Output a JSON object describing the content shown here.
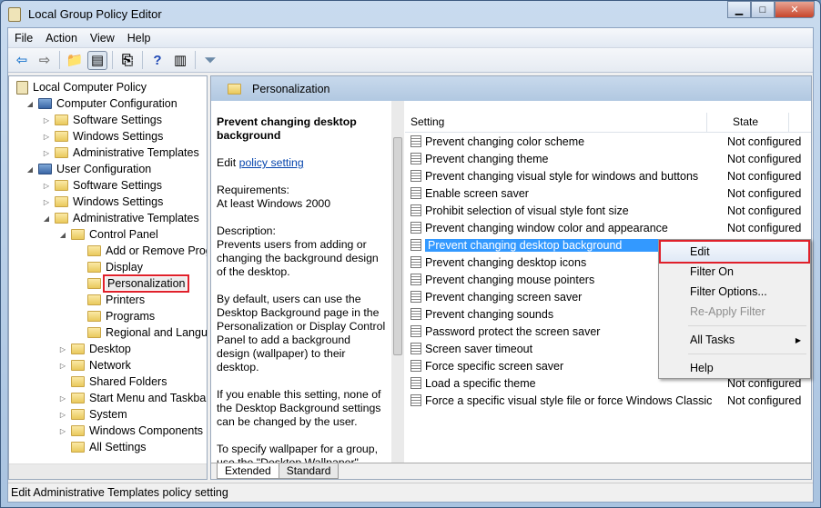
{
  "window": {
    "title": "Local Group Policy Editor",
    "minimize": "▁",
    "maximize": "□",
    "close": "✕"
  },
  "menu": [
    "File",
    "Action",
    "View",
    "Help"
  ],
  "toolbar": [
    {
      "icon": "back-arrow-icon",
      "glyph": "⇦",
      "color": "#2c7fd1"
    },
    {
      "icon": "forward-arrow-icon",
      "glyph": "⇨",
      "color": "#777777"
    },
    {
      "icon": "up-folder-icon",
      "glyph": "📁"
    },
    {
      "icon": "show-hide-tree-icon",
      "glyph": "▤",
      "on": true
    },
    {
      "icon": "export-list-icon",
      "glyph": "⎘"
    },
    {
      "icon": "help-icon",
      "glyph": "?",
      "color": "#2049b5"
    },
    {
      "icon": "show-action-pane-icon",
      "glyph": "▥"
    },
    {
      "icon": "filter-icon",
      "glyph": "⏷",
      "color": "#6b8aa8"
    }
  ],
  "tree": [
    {
      "label": "Local Computer Policy",
      "level": 0,
      "arrow": "",
      "icon": "root"
    },
    {
      "label": "Computer Configuration",
      "level": 1,
      "arrow": "◢",
      "icon": "comp"
    },
    {
      "label": "Software Settings",
      "level": 2,
      "arrow": "▷"
    },
    {
      "label": "Windows Settings",
      "level": 2,
      "arrow": "▷"
    },
    {
      "label": "Administrative Templates",
      "level": 2,
      "arrow": "▷"
    },
    {
      "label": "User Configuration",
      "level": 1,
      "arrow": "◢",
      "icon": "comp"
    },
    {
      "label": "Software Settings",
      "level": 2,
      "arrow": "▷"
    },
    {
      "label": "Windows Settings",
      "level": 2,
      "arrow": "▷"
    },
    {
      "label": "Administrative Templates",
      "level": 2,
      "arrow": "◢"
    },
    {
      "label": "Control Panel",
      "level": 3,
      "arrow": "◢"
    },
    {
      "label": "Add or Remove Programs",
      "level": 4,
      "arrow": ""
    },
    {
      "label": "Display",
      "level": 4,
      "arrow": ""
    },
    {
      "label": "Personalization",
      "level": 4,
      "arrow": "",
      "selected": true
    },
    {
      "label": "Printers",
      "level": 4,
      "arrow": ""
    },
    {
      "label": "Programs",
      "level": 4,
      "arrow": ""
    },
    {
      "label": "Regional and Language Options",
      "level": 4,
      "arrow": ""
    },
    {
      "label": "Desktop",
      "level": 3,
      "arrow": "▷"
    },
    {
      "label": "Network",
      "level": 3,
      "arrow": "▷"
    },
    {
      "label": "Shared Folders",
      "level": 3,
      "arrow": ""
    },
    {
      "label": "Start Menu and Taskbar",
      "level": 3,
      "arrow": "▷"
    },
    {
      "label": "System",
      "level": 3,
      "arrow": "▷"
    },
    {
      "label": "Windows Components",
      "level": 3,
      "arrow": "▷"
    },
    {
      "label": "All Settings",
      "level": 3,
      "arrow": ""
    }
  ],
  "main": {
    "header": "Personalization",
    "description": {
      "title": "Prevent changing desktop background",
      "edit_prefix": "Edit ",
      "edit_link": "policy setting",
      "requirements": "Requirements:\nAt least Windows 2000",
      "desc": "Description:\nPrevents users from adding or changing the background design of the desktop.",
      "p2": "By default, users can use the Desktop Background page in the Personalization or Display Control Panel to add a background design (wallpaper) to their desktop.",
      "p3": "If you enable this setting, none of the Desktop Background settings can be changed by the user.",
      "p4": "To specify wallpaper for a group, use the \"Desktop Wallpaper\" setting."
    },
    "columns": [
      "Setting",
      "State"
    ],
    "rows": [
      {
        "setting": "Prevent changing color scheme",
        "state": "Not configured"
      },
      {
        "setting": "Prevent changing theme",
        "state": "Not configured"
      },
      {
        "setting": "Prevent changing visual style for windows and buttons",
        "state": "Not configured"
      },
      {
        "setting": "Enable screen saver",
        "state": "Not configured"
      },
      {
        "setting": "Prohibit selection of visual style font size",
        "state": "Not configured"
      },
      {
        "setting": "Prevent changing window color and appearance",
        "state": "Not configured"
      },
      {
        "setting": "Prevent changing desktop background",
        "state": "",
        "selected": true
      },
      {
        "setting": "Prevent changing desktop icons",
        "state": ""
      },
      {
        "setting": "Prevent changing mouse pointers",
        "state": ""
      },
      {
        "setting": "Prevent changing screen saver",
        "state": ""
      },
      {
        "setting": "Prevent changing sounds",
        "state": ""
      },
      {
        "setting": "Password protect the screen saver",
        "state": ""
      },
      {
        "setting": "Screen saver timeout",
        "state": ""
      },
      {
        "setting": "Force specific screen saver",
        "state": ""
      },
      {
        "setting": "Load a specific theme",
        "state": "Not configured"
      },
      {
        "setting": "Force a specific visual style file or force Windows Classic",
        "state": "Not configured"
      }
    ],
    "tabs": [
      "Extended",
      "Standard"
    ]
  },
  "context_menu": [
    {
      "label": "Edit",
      "highlight": true
    },
    {
      "label": "Filter On"
    },
    {
      "label": "Filter Options..."
    },
    {
      "label": "Re-Apply Filter",
      "disabled": true
    },
    {
      "sep": true
    },
    {
      "label": "All Tasks",
      "submenu": true
    },
    {
      "sep": true
    },
    {
      "label": "Help"
    }
  ],
  "status": "Edit Administrative Templates policy setting"
}
